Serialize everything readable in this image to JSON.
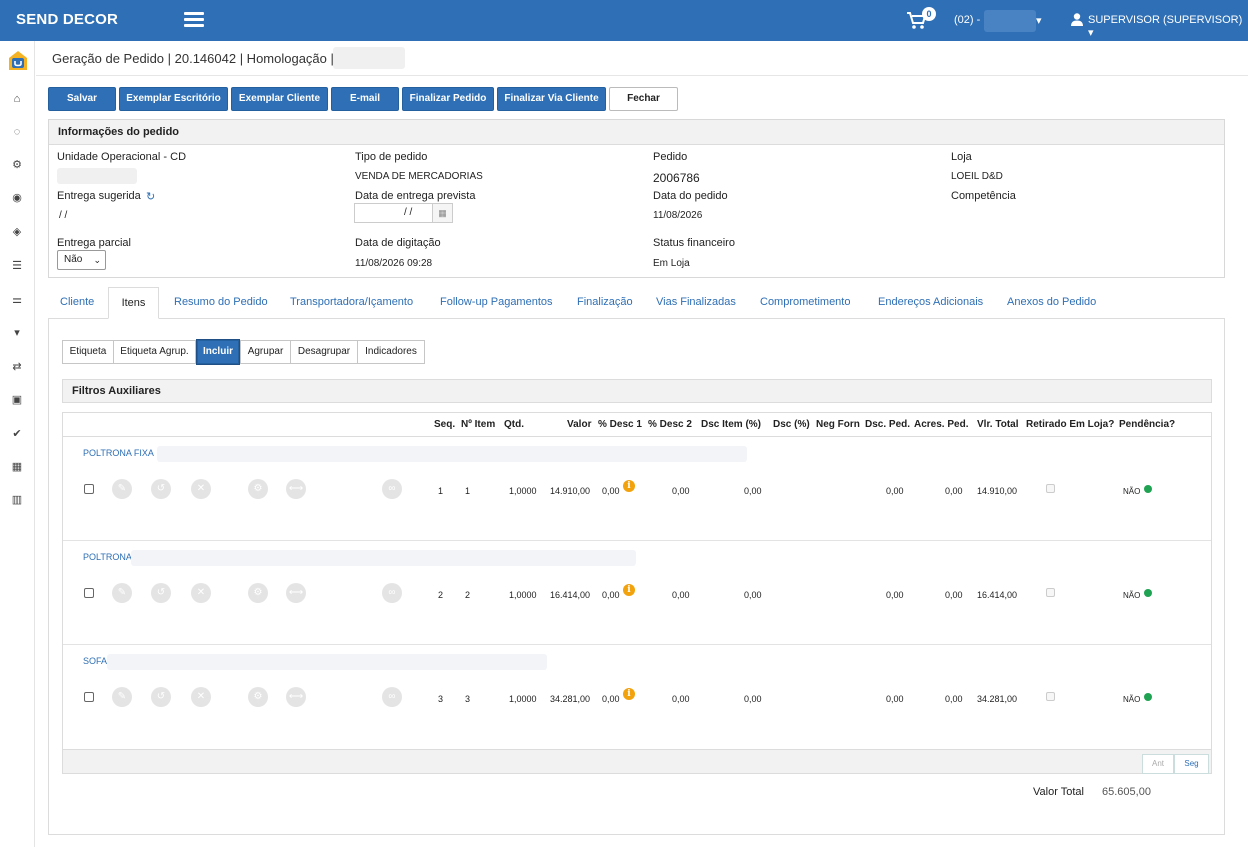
{
  "app": {
    "brand": "SEND DECOR"
  },
  "topbar": {
    "cart_count": "0",
    "store_prefix": "(02) -",
    "store_caret": "▾",
    "user_label": "SUPERVISOR (SUPERVISOR) ▾"
  },
  "sidebar": {
    "icons": [
      "home-icon",
      "spinner-icon",
      "cogs-icon",
      "target-icon",
      "cube-icon",
      "database-icon",
      "sliders-icon",
      "cart-icon",
      "exchange-icon",
      "briefcase-icon",
      "check-icon",
      "barcode-icon",
      "bar-chart-icon"
    ]
  },
  "header": {
    "title": "Geração de Pedido | 20.146042 | Homologação |"
  },
  "toolbar": {
    "salvar": "Salvar",
    "exemplar_escritorio": "Exemplar Escritório",
    "exemplar_cliente": "Exemplar Cliente",
    "email": "E-mail",
    "finalizar_pedido": "Finalizar Pedido",
    "finalizar_via_cliente": "Finalizar Via Cliente",
    "fechar": "Fechar"
  },
  "info": {
    "title": "Informações do pedido",
    "unidade_label": "Unidade Operacional - CD",
    "tipo_label": "Tipo de pedido",
    "tipo_value": "VENDA DE MERCADORIAS",
    "pedido_label": "Pedido",
    "pedido_value": "2006786",
    "loja_label": "Loja",
    "loja_value": "LOEIL D&D",
    "entrega_sugerida_label": "Entrega sugerida",
    "entrega_sugerida_value": "/ /",
    "data_entrega_label": "Data de entrega prevista",
    "data_entrega_value": "/ /",
    "data_pedido_label": "Data do pedido",
    "data_pedido_value": "11/08/2026",
    "competencia_label": "Competência",
    "entrega_parcial_label": "Entrega parcial",
    "entrega_parcial_value": "Não",
    "data_digitacao_label": "Data de digitação",
    "data_digitacao_value": "11/08/2026 09:28",
    "status_label": "Status financeiro",
    "status_value": "Em Loja"
  },
  "tabs": [
    "Cliente",
    "Itens",
    "Resumo do Pedido",
    "Transportadora/Içamento",
    "Follow-up Pagamentos",
    "Finalização",
    "Vias Finalizadas",
    "Comprometimento",
    "Endereços Adicionais",
    "Anexos do Pedido"
  ],
  "subtabs": [
    "Etiqueta",
    "Etiqueta Agrup.",
    "Incluir",
    "Agrupar",
    "Desagrupar",
    "Indicadores"
  ],
  "filters": {
    "title": "Filtros Auxiliares"
  },
  "grid": {
    "headers": [
      "Seq.",
      "Nº Item",
      "Qtd.",
      "Valor",
      "% Desc 1",
      "% Desc 2",
      "Dsc Item (%)",
      "Dsc (%)",
      "Neg Forn",
      "Dsc. Ped.",
      "Acres. Ped.",
      "Vlr. Total",
      "Retirado Em Loja?",
      "Pendência?"
    ],
    "rows": [
      {
        "name": "POLTRONA FIXA",
        "seq": "1",
        "item": "1",
        "qtd": "1,0000",
        "valor": "14.910,00",
        "desc1": "0,00",
        "desc2": "0,00",
        "dsc_item": "0,00",
        "dsc_ped": "0,00",
        "acres_ped": "0,00",
        "total": "14.910,00",
        "pendencia": "NÃO"
      },
      {
        "name": "POLTRONA",
        "seq": "2",
        "item": "2",
        "qtd": "1,0000",
        "valor": "16.414,00",
        "desc1": "0,00",
        "desc2": "0,00",
        "dsc_item": "0,00",
        "dsc_ped": "0,00",
        "acres_ped": "0,00",
        "total": "16.414,00",
        "pendencia": "NÃO"
      },
      {
        "name": "SOFA",
        "seq": "3",
        "item": "3",
        "qtd": "1,0000",
        "valor": "34.281,00",
        "desc1": "0,00",
        "desc2": "0,00",
        "dsc_item": "0,00",
        "dsc_ped": "0,00",
        "acres_ped": "0,00",
        "total": "34.281,00",
        "pendencia": "NÃO"
      }
    ],
    "pager_prev": "Ant",
    "pager_next": "Seg"
  },
  "totals": {
    "label": "Valor Total",
    "value": "65.605,00"
  },
  "colors": {
    "primary": "#2e6fb5",
    "warning": "#f2a20c",
    "success": "#1fa352"
  }
}
